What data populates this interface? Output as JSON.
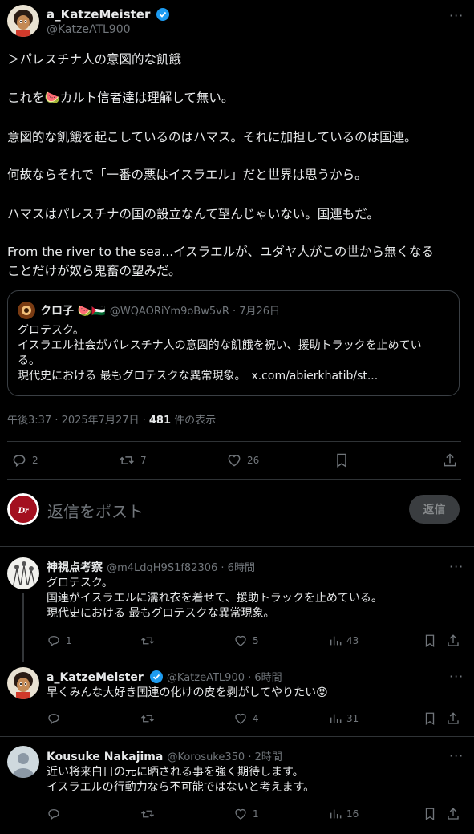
{
  "main_post": {
    "display_name": "a_KatzeMeister",
    "handle": "@KatzeATL900",
    "lines": [
      "＞パレスチナ人の意図的な飢餓",
      "これを🍉カルト信者達は理解して無い。",
      "意図的な飢餓を起こしているのはハマス。それに加担しているのは国連。",
      "何故ならそれで「一番の悪はイスラエル」だと世界は思うから。",
      "ハマスはパレスチナの国の設立なんて望んじゃいない。国連もだ。",
      "From the river to the sea...イスラエルが、ユダヤ人がこの世から無くなる\nことだけが奴ら鬼畜の望みだ。"
    ],
    "timestamp": "午後3:37 · 2025年7月27日 · ",
    "views_count": "481",
    "views_suffix": " 件の表示",
    "replies": "2",
    "reposts": "7",
    "likes": "26"
  },
  "quote": {
    "display_name": "クロ子 🍉🇵🇸",
    "handle": "@WQAORiYm9oBw5vR · 7月26日",
    "text": "グロテスク。\nイスラエル社会がパレスチナ人の意図的な飢餓を祝い、援助トラックを止めてい\nる。\n現代史における 最もグロテスクな異常現象。　x.com/abierkhatib/st..."
  },
  "composer": {
    "placeholder": "返信をポスト",
    "reply_button": "返信"
  },
  "replies": [
    {
      "display_name": "神視点考察",
      "handle": "@m4LdqH9S1f82306 · 6時間",
      "text": "グロテスク。\n国連がイスラエルに濡れ衣を着せて、援助トラックを止めている。\n現代史における 最もグロテスクな異常現象。",
      "replies": "1",
      "reposts": "",
      "likes": "5",
      "views": "43"
    },
    {
      "display_name": "a_KatzeMeister",
      "handle": "@KatzeATL900 · 6時間",
      "text": "早くみんな大好き国連の化けの皮を剥がしてやりたい😡",
      "replies": "",
      "reposts": "",
      "likes": "4",
      "views": "31"
    },
    {
      "display_name": "Kousuke Nakajima",
      "handle": "@Korosuke350 · 2時間",
      "text": "近い将来白日の元に晒される事を強く期待します。\nイスラエルの行動力なら不可能ではないと考えます。",
      "replies": "",
      "reposts": "",
      "likes": "1",
      "views": "16"
    }
  ],
  "colors": {
    "background": "#000000",
    "text": "#e7e9ea",
    "muted": "#71767b",
    "divider": "#2f3336",
    "verified": "#1d9bf0"
  },
  "icons": [
    "more-icon",
    "verified-badge-icon",
    "reply-icon",
    "repost-icon",
    "like-icon",
    "bookmark-icon",
    "share-icon",
    "views-icon"
  ]
}
